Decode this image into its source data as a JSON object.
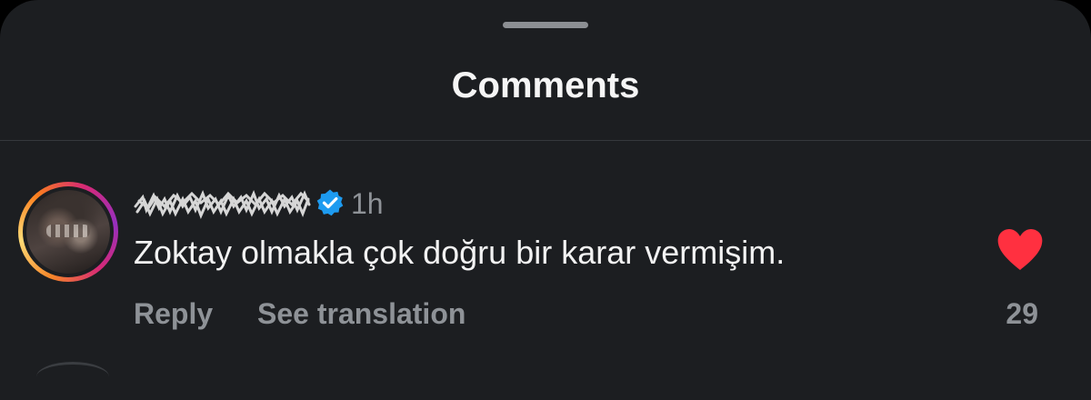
{
  "sheet": {
    "title": "Comments"
  },
  "comment": {
    "username_state": "redacted",
    "verified": true,
    "timestamp": "1h",
    "text": "Zoktay olmakla çok doğru bir karar vermişim.",
    "liked": true,
    "like_count": "29",
    "actions": {
      "reply_label": "Reply",
      "translate_label": "See translation"
    }
  },
  "icons": {
    "verified": "verified-badge-icon",
    "like": "heart-icon"
  },
  "colors": {
    "background": "#1c1e21",
    "verified_blue": "#1d9bf0",
    "like_red": "#ff3040",
    "secondary_text": "#8e9297"
  }
}
